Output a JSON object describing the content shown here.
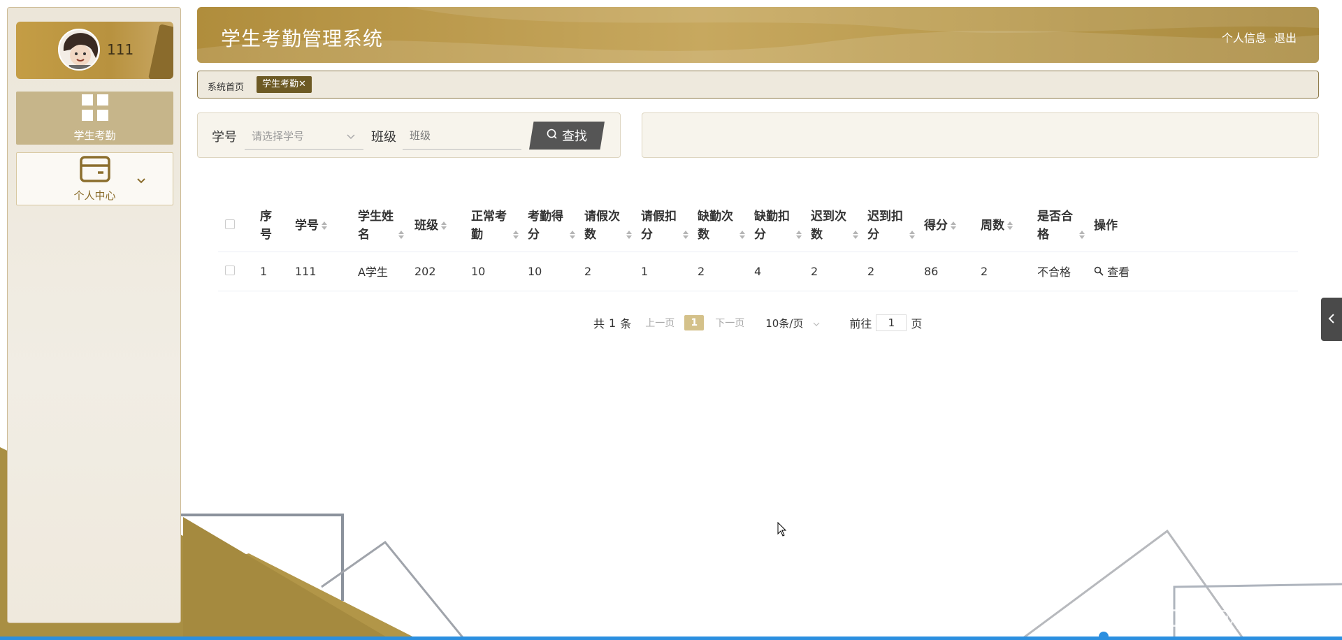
{
  "app": {
    "title": "学生考勤管理系统",
    "header_links": [
      "个人信息",
      "退出"
    ]
  },
  "sidebar": {
    "user_name": "111",
    "items": [
      {
        "label": "学生考勤",
        "icon": "grid-icon",
        "active": true
      },
      {
        "label": "个人中心",
        "icon": "card-icon",
        "active": false
      }
    ]
  },
  "tabs": {
    "home": "系统首页",
    "active": "学生考勤"
  },
  "search": {
    "student_id_label": "学号",
    "student_id_placeholder": "请选择学号",
    "class_label": "班级",
    "class_placeholder": "班级",
    "button_label": "查找"
  },
  "table": {
    "columns": [
      {
        "label": "序号",
        "sortable": false
      },
      {
        "label": "学号",
        "sortable": true
      },
      {
        "label": "学生姓名",
        "sortable": true
      },
      {
        "label": "班级",
        "sortable": true
      },
      {
        "label": "正常考勤",
        "sortable": true
      },
      {
        "label": "考勤得分",
        "sortable": true
      },
      {
        "label": "请假次数",
        "sortable": true
      },
      {
        "label": "请假扣分",
        "sortable": true
      },
      {
        "label": "缺勤次数",
        "sortable": true
      },
      {
        "label": "缺勤扣分",
        "sortable": true
      },
      {
        "label": "迟到次数",
        "sortable": true
      },
      {
        "label": "迟到扣分",
        "sortable": true
      },
      {
        "label": "得分",
        "sortable": true
      },
      {
        "label": "周数",
        "sortable": true
      },
      {
        "label": "是否合格",
        "sortable": true
      },
      {
        "label": "操作",
        "sortable": false
      }
    ],
    "rows": [
      [
        "1",
        "111",
        "A学生",
        "202",
        "10",
        "10",
        "2",
        "1",
        "2",
        "4",
        "2",
        "2",
        "86",
        "2",
        "不合格"
      ]
    ],
    "action_label": "查看"
  },
  "pagination": {
    "total_prefix": "共",
    "total": "1",
    "total_suffix": "条",
    "prev": "上一页",
    "current": "1",
    "next": "下一页",
    "page_size": "10条/页",
    "goto_prefix": "前往",
    "goto_value": "1",
    "goto_suffix": "页"
  },
  "watermark": "CSDN @茹茹学姐",
  "colors": {
    "gold": "#b08d3c",
    "dark_gold": "#6d5a24",
    "active_page": "#d4c18a"
  }
}
